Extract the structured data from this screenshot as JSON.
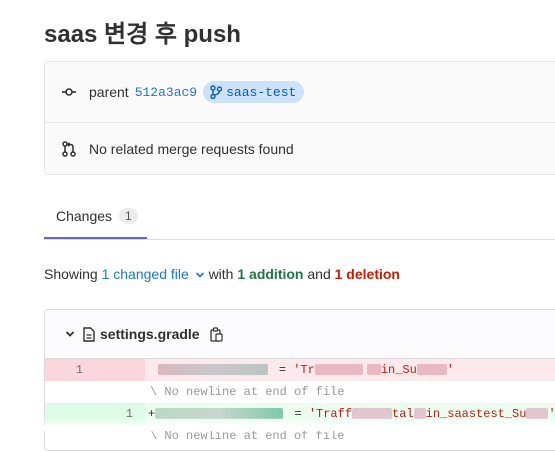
{
  "page": {
    "title": "saas 변경 후 push"
  },
  "commit_info": {
    "parent_label": "parent",
    "parent_sha": "512a3ac9",
    "branch": "saas-test",
    "merge_requests_text": "No related merge requests found"
  },
  "tabs": [
    {
      "label": "Changes",
      "count": "1"
    }
  ],
  "summary": {
    "showing": "Showing",
    "changed_files": "1 changed file",
    "with": "with",
    "additions": "1 addition",
    "and": "and",
    "deletions": "1 deletion"
  },
  "file": {
    "name": "settings.gradle",
    "lines": [
      {
        "type": "deletion",
        "old": "1",
        "new": "",
        "eq": "=",
        "str_start": "'Tr",
        "str_mid": "in_Su",
        "str_end": "'"
      },
      {
        "type": "meta",
        "text": "\\ No newline at end of file"
      },
      {
        "type": "addition",
        "old": "",
        "new": "1",
        "prefix": "+",
        "eq": "=",
        "str_start": "'Traff",
        "str_mid1": "tal",
        "str_mid2": "in_saastest_Su",
        "str_end": "'"
      },
      {
        "type": "meta",
        "text": "\\ No newline at end of file"
      }
    ]
  }
}
